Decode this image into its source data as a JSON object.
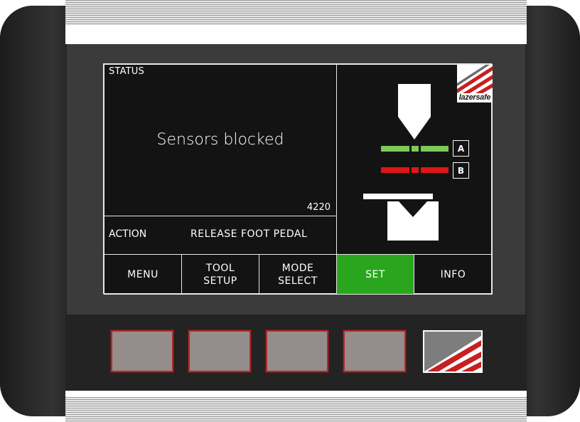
{
  "screen": {
    "status": {
      "label": "STATUS",
      "message": "Sensors blocked",
      "code": "4220"
    },
    "action": {
      "label": "ACTION",
      "value": "RELEASE FOOT PEDAL"
    },
    "logo_text": "lazersafe",
    "beam_labels": {
      "a": "A",
      "b": "B"
    },
    "softkeys": [
      {
        "label": "MENU"
      },
      {
        "label": "TOOL\nSETUP"
      },
      {
        "label": "MODE\nSELECT"
      },
      {
        "label": "SET",
        "active": true
      },
      {
        "label": "INFO"
      }
    ]
  },
  "colors": {
    "active_softkey": "#2aa61e",
    "beam_a": "#7dc95a",
    "beam_b": "#e01616",
    "hard_button": "#958c8c",
    "hard_button_border": "#b32a2a"
  },
  "icons": {
    "punch": "punch-tool-icon",
    "die": "v-die-icon",
    "brand": "lazersafe-logo"
  }
}
